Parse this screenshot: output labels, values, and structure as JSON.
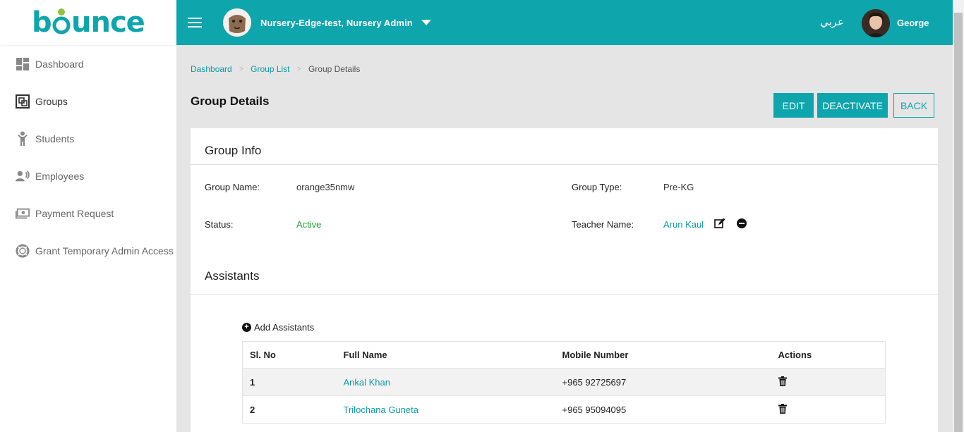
{
  "app": {
    "logo_text": "bounce"
  },
  "sidebar": {
    "items": [
      {
        "label": "Dashboard",
        "icon": "dashboard-icon"
      },
      {
        "label": "Groups",
        "icon": "groups-icon"
      },
      {
        "label": "Students",
        "icon": "student-icon"
      },
      {
        "label": "Employees",
        "icon": "employees-icon"
      },
      {
        "label": "Payment Request",
        "icon": "payment-icon"
      },
      {
        "label": "Grant Temporary Admin Access",
        "icon": "lifebuoy-icon"
      }
    ]
  },
  "topbar": {
    "org_name": "Nursery-Edge-test, Nursery Admin",
    "language": "عربي",
    "user_name": "George"
  },
  "breadcrumb": {
    "items": [
      "Dashboard",
      "Group List"
    ],
    "current": "Group Details"
  },
  "page": {
    "title": "Group Details",
    "buttons": {
      "edit": "EDIT",
      "deactivate": "DEACTIVATE",
      "back": "BACK"
    }
  },
  "group_info": {
    "title": "Group Info",
    "group_name_label": "Group Name:",
    "group_name": "orange35nmw",
    "group_type_label": "Group Type:",
    "group_type": "Pre-KG",
    "status_label": "Status:",
    "status": "Active",
    "teacher_label": "Teacher Name:",
    "teacher": "Arun Kaul"
  },
  "assistants": {
    "title": "Assistants",
    "add_label": "Add Assistants",
    "columns": [
      "Sl. No",
      "Full Name",
      "Mobile Number",
      "Actions"
    ],
    "rows": [
      {
        "no": "1",
        "name": "Ankal Khan",
        "mobile": "+965 92725697"
      },
      {
        "no": "2",
        "name": "Trilochana Guneta",
        "mobile": "+965 95094095"
      }
    ]
  },
  "colors": {
    "brand": "#0ea5ad",
    "active": "#1fa43a",
    "link": "#0e9aa2"
  }
}
